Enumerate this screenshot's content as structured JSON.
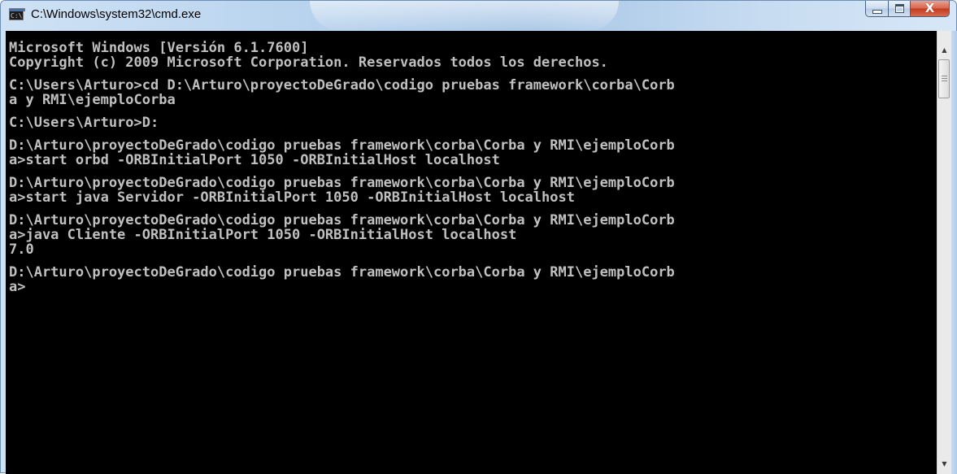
{
  "window": {
    "title": "C:\\Windows\\system32\\cmd.exe",
    "app_icon_text": "C:\\"
  },
  "caption_buttons": {
    "minimize_icon": "minimize-icon",
    "maximize_icon": "maximize-icon",
    "close_glyph": "X"
  },
  "console": {
    "text_color": "#c0c0c0",
    "background_color": "#000000",
    "lines": [
      "Microsoft Windows [Versión 6.1.7600]",
      "Copyright (c) 2009 Microsoft Corporation. Reservados todos los derechos.",
      "",
      "C:\\Users\\Arturo>cd D:\\Arturo\\proyectoDeGrado\\codigo pruebas framework\\corba\\Corb",
      "a y RMI\\ejemploCorba",
      "",
      "C:\\Users\\Arturo>D:",
      "",
      "D:\\Arturo\\proyectoDeGrado\\codigo pruebas framework\\corba\\Corba y RMI\\ejemploCorb",
      "a>start orbd -ORBInitialPort 1050 -ORBInitialHost localhost",
      "",
      "D:\\Arturo\\proyectoDeGrado\\codigo pruebas framework\\corba\\Corba y RMI\\ejemploCorb",
      "a>start java Servidor -ORBInitialPort 1050 -ORBInitialHost localhost",
      "",
      "D:\\Arturo\\proyectoDeGrado\\codigo pruebas framework\\corba\\Corba y RMI\\ejemploCorb",
      "a>java Cliente -ORBInitialPort 1050 -ORBInitialHost localhost",
      "7.0",
      "",
      "D:\\Arturo\\proyectoDeGrado\\codigo pruebas framework\\corba\\Corba y RMI\\ejemploCorb",
      "a>"
    ]
  },
  "scrollbar": {
    "up_icon": "scroll-up-arrow-icon",
    "down_icon": "scroll-down-arrow-icon",
    "up_glyph": "▲",
    "down_glyph": "▼"
  }
}
